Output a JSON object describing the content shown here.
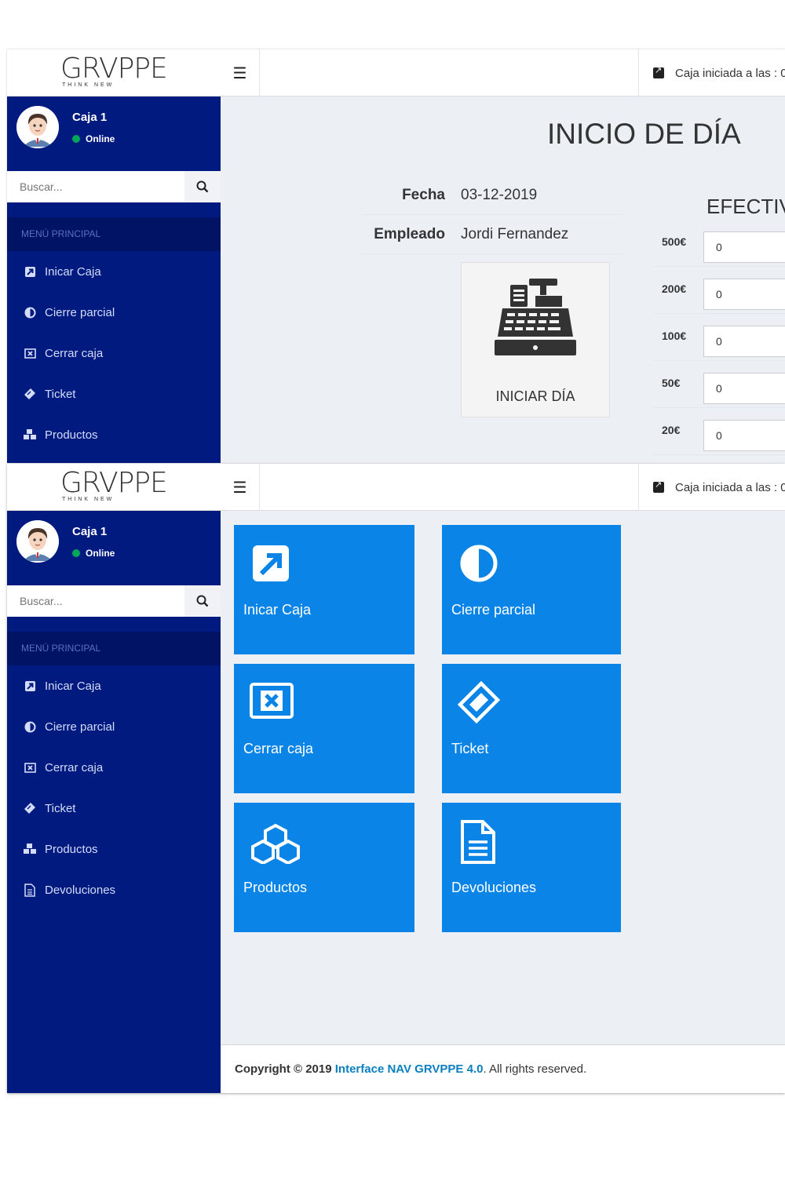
{
  "brand": {
    "logo": "GRVPPE",
    "tagline": "THINK NEW"
  },
  "header": {
    "status_text": "Caja iniciada a las : 0"
  },
  "user": {
    "name": "Caja 1",
    "status": "Online"
  },
  "search": {
    "placeholder": "Buscar..."
  },
  "menu": {
    "header": "MENÚ PRINCIPAL",
    "items": [
      {
        "label": "Inicar Caja",
        "icon": "external-link-icon"
      },
      {
        "label": "Cierre parcial",
        "icon": "half-circle-icon"
      },
      {
        "label": "Cerrar caja",
        "icon": "close-box-icon"
      },
      {
        "label": "Ticket",
        "icon": "ticket-icon"
      },
      {
        "label": "Productos",
        "icon": "cubes-icon"
      },
      {
        "label": "Devoluciones",
        "icon": "document-icon"
      }
    ]
  },
  "inicio": {
    "title": "INICIO DE DÍA",
    "fecha_label": "Fecha",
    "fecha_value": "03-12-2019",
    "empleado_label": "Empleado",
    "empleado_value": "Jordi Fernandez",
    "start_button": "INICIAR DÍA",
    "efectivo_title": "EFECTIVO",
    "cash": [
      {
        "denomination": "500€",
        "value": "0"
      },
      {
        "denomination": "200€",
        "value": "0"
      },
      {
        "denomination": "100€",
        "value": "0"
      },
      {
        "denomination": "50€",
        "value": "0"
      },
      {
        "denomination": "20€",
        "value": "0"
      }
    ]
  },
  "dashboard": {
    "tiles": [
      {
        "label": "Inicar Caja",
        "icon": "external-link-icon"
      },
      {
        "label": "Cierre parcial",
        "icon": "half-circle-icon"
      },
      {
        "label": "Cerrar caja",
        "icon": "close-box-icon"
      },
      {
        "label": "Ticket",
        "icon": "ticket-icon"
      },
      {
        "label": "Productos",
        "icon": "cubes-icon"
      },
      {
        "label": "Devoluciones",
        "icon": "document-icon"
      }
    ]
  },
  "footer": {
    "copyright": "Copyright © 2019",
    "product": "Interface NAV GRVPPE 4.0",
    "rights": ". All rights reserved."
  },
  "colors": {
    "sidebar": "#001a80",
    "menu_header": "#001364",
    "tile": "#0a84e6",
    "online": "#00a65a"
  }
}
